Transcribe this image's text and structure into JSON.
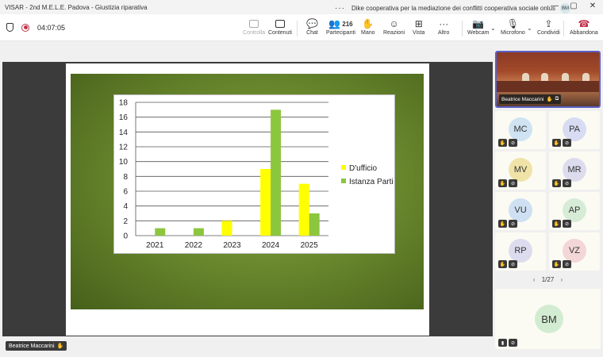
{
  "window": {
    "title": "VISAR - 2nd M.E.L.E. Padova - Giustizia riparativa",
    "org": "Dike cooperativa per la mediazione dei conflitti cooperativa sociale onlus",
    "user_initials": "BM",
    "min_icon": "minimize-icon",
    "max_icon": "maximize-icon",
    "close_icon": "close-icon"
  },
  "toolbar": {
    "timer": "04:07:05",
    "controlla": "Controlla",
    "contenuti": "Contenuti",
    "chat": "Chat",
    "partecipanti": "Partecipanti",
    "participant_count": "216",
    "mano": "Mano",
    "reazioni": "Reazioni",
    "vista": "Vista",
    "altro": "Altro",
    "webcam": "Webcam",
    "microfono": "Microfono",
    "condividi": "Condividi",
    "abbandona": "Abbandona"
  },
  "chart_data": {
    "type": "bar",
    "categories": [
      "2021",
      "2022",
      "2023",
      "2024",
      "2025"
    ],
    "series": [
      {
        "name": "D'ufficio",
        "color": "#ffff00",
        "values": [
          0,
          0,
          2,
          9,
          7
        ]
      },
      {
        "name": "Istanza Parti",
        "color": "#8cc63e",
        "values": [
          1,
          1,
          0,
          17,
          3
        ]
      }
    ],
    "ylim": [
      0,
      18
    ],
    "yticks": [
      "0",
      "2",
      "4",
      "6",
      "8",
      "10",
      "12",
      "14",
      "16",
      "18"
    ],
    "grid": true,
    "legend": "right"
  },
  "sidebar": {
    "speaker_name": "Beatrice Maccarini",
    "participants": [
      {
        "initials": "MC",
        "color": "#cfe3f3"
      },
      {
        "initials": "PA",
        "color": "#d8dcf3"
      },
      {
        "initials": "MV",
        "color": "#efe3a8"
      },
      {
        "initials": "MR",
        "color": "#dcdcee"
      },
      {
        "initials": "VU",
        "color": "#cfe0f3"
      },
      {
        "initials": "AP",
        "color": "#d7ecd7"
      },
      {
        "initials": "RP",
        "color": "#dcdcee"
      },
      {
        "initials": "VZ",
        "color": "#f3d6d6"
      }
    ],
    "pager": "1/27",
    "self_initials": "BM"
  },
  "presenter_label": "Beatrice Maccarini"
}
